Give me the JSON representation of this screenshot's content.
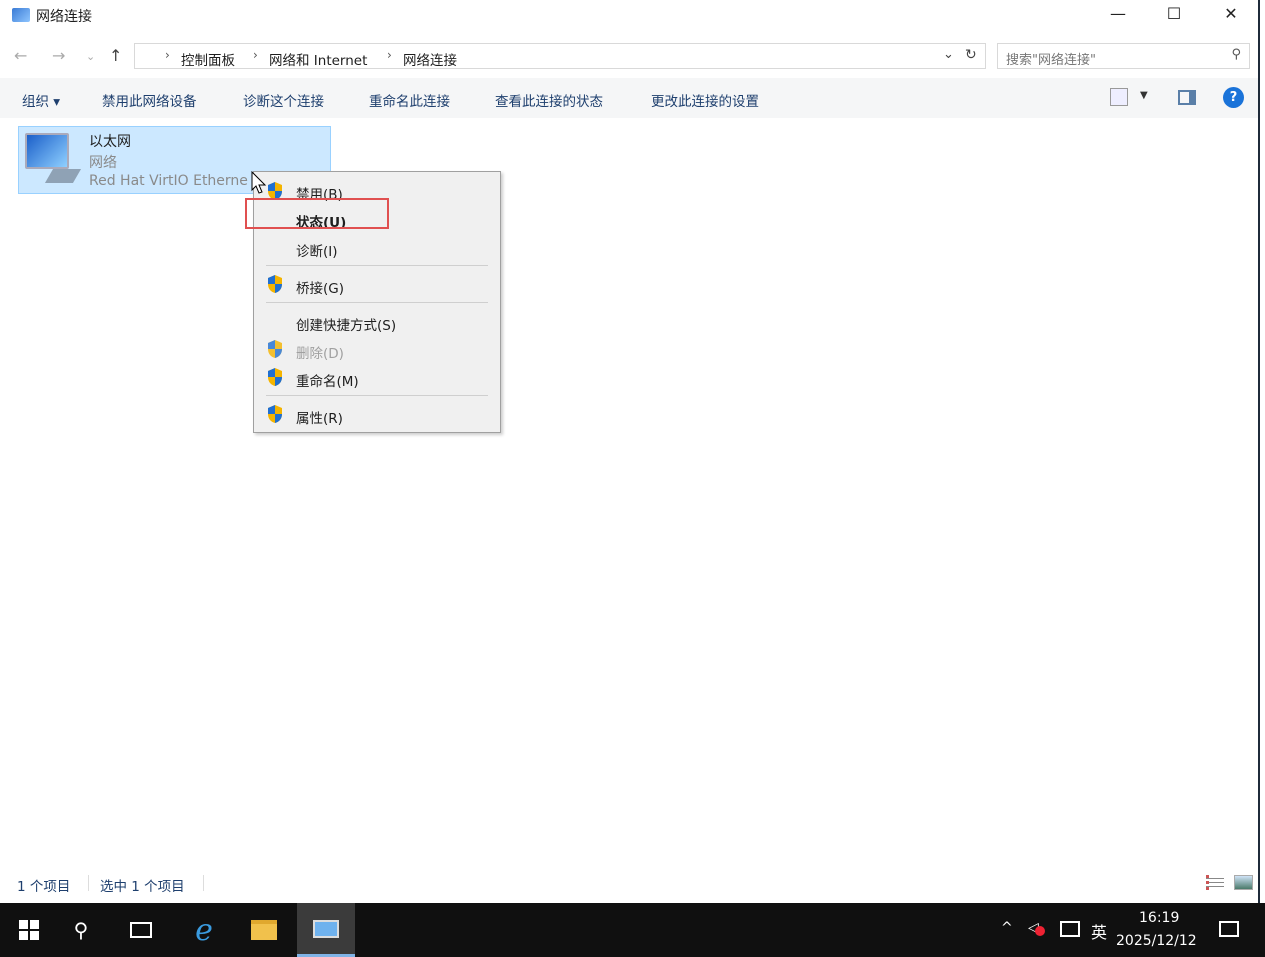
{
  "window": {
    "title": "网络连接",
    "minimize": "—",
    "maximize": "☐",
    "close": "✕"
  },
  "address": {
    "crumbs": [
      "控制面板",
      "网络和 Internet",
      "网络连接"
    ],
    "search_placeholder": "搜索\"网络连接\""
  },
  "toolbar": {
    "organize": "组织 ▾",
    "items": [
      "禁用此网络设备",
      "诊断这个连接",
      "重命名此连接",
      "查看此连接的状态",
      "更改此连接的设置"
    ],
    "help": "?"
  },
  "connection": {
    "name": "以太网",
    "network": "网络",
    "adapter": "Red Hat VirtIO Etherne"
  },
  "context_menu": {
    "items": [
      {
        "label": "禁用(B)",
        "shield": true
      },
      {
        "label": "状态(U)",
        "shield": false
      },
      {
        "label": "诊断(I)",
        "shield": false
      },
      {
        "label": "桥接(G)",
        "shield": true
      },
      {
        "label": "创建快捷方式(S)",
        "shield": false
      },
      {
        "label": "删除(D)",
        "shield": true,
        "disabled": true
      },
      {
        "label": "重命名(M)",
        "shield": true
      },
      {
        "label": "属性(R)",
        "shield": true
      }
    ]
  },
  "status": {
    "count": "1 个项目",
    "selected": "选中 1 个项目"
  },
  "taskbar": {
    "time": "16:19",
    "date": "2025/12/12",
    "ime": "英"
  }
}
